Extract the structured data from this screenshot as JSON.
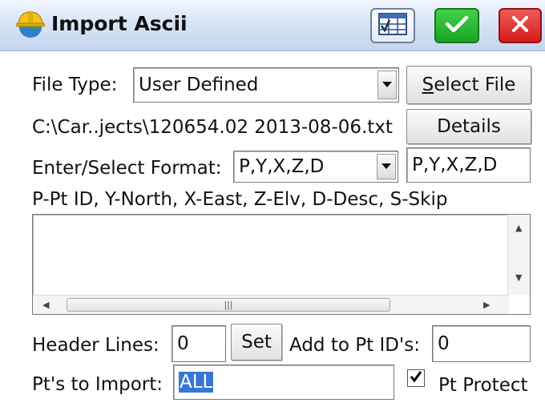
{
  "window": {
    "title": "Import Ascii",
    "icons": [
      "hardhat-globe-icon",
      "grid-icon",
      "checkmark-icon",
      "close-icon"
    ],
    "colors": {
      "ok": "#1aa323",
      "close": "#d41b1b",
      "title_bar": "#c4d5ef"
    }
  },
  "file_type": {
    "label": "File Type:",
    "value": "User Defined"
  },
  "select_file_button": {
    "label_first": "S",
    "label_rest": "elect File"
  },
  "file_path": "C:\\Car..jects\\120654.02 2013-08-06.txt",
  "details_button": "Details",
  "format": {
    "label": "Enter/Select Format:",
    "selected": "P,Y,X,Z,D",
    "text": "P,Y,X,Z,D"
  },
  "legend": "P-Pt ID, Y-North, X-East, Z-Elv, D-Desc, S-Skip",
  "preview_text": "",
  "header_lines": {
    "label": "Header Lines:",
    "value": "0",
    "set_button": "Set"
  },
  "add_to_pt_ids": {
    "label": "Add to Pt ID's:",
    "value": "0"
  },
  "pts_to_import": {
    "label": "Pt's to Import:",
    "value": "ALL"
  },
  "pt_protect": {
    "label": "Pt Protect",
    "checked": true
  }
}
